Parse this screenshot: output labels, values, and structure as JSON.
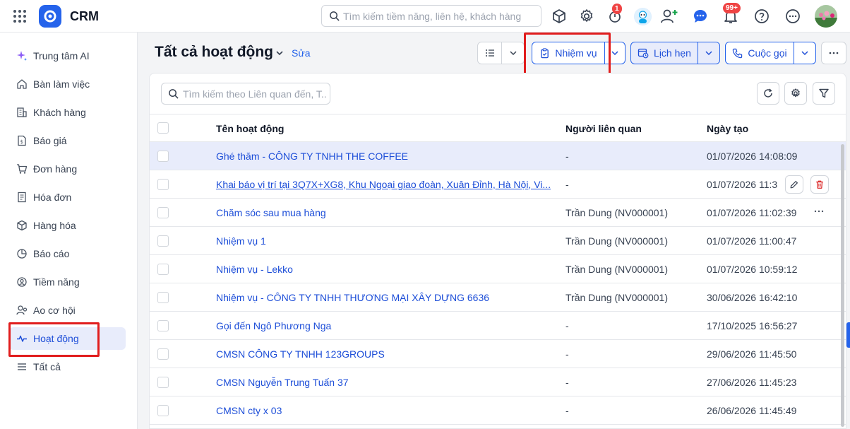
{
  "app": {
    "name": "CRM"
  },
  "search": {
    "placeholder": "Tìm kiếm tiềm năng, liên hệ, khách hàng"
  },
  "notifications": {
    "timer_badge": "1",
    "bell_badge": "99+"
  },
  "sidebar": {
    "items": [
      {
        "label": "Trung tâm AI",
        "icon": "sparkle-icon"
      },
      {
        "label": "Bàn làm việc",
        "icon": "home-icon"
      },
      {
        "label": "Khách hàng",
        "icon": "building-icon"
      },
      {
        "label": "Báo giá",
        "icon": "quote-icon"
      },
      {
        "label": "Đơn hàng",
        "icon": "cart-icon"
      },
      {
        "label": "Hóa đơn",
        "icon": "invoice-icon"
      },
      {
        "label": "Hàng hóa",
        "icon": "box-icon"
      },
      {
        "label": "Báo cáo",
        "icon": "chart-icon"
      },
      {
        "label": "Tiềm năng",
        "icon": "target-icon"
      },
      {
        "label": "Ao cơ hội",
        "icon": "opportunity-icon"
      },
      {
        "label": "Hoạt động",
        "icon": "activity-icon",
        "active": true
      },
      {
        "label": "Tất cả",
        "icon": "menu-icon"
      }
    ]
  },
  "header": {
    "title": "Tất cả hoạt động",
    "edit_label": "Sửa",
    "task_button": "Nhiệm vụ",
    "appointment_button": "Lịch hẹn",
    "call_button": "Cuộc gọi"
  },
  "table": {
    "search_placeholder": "Tìm kiếm theo Liên quan đến, T...",
    "columns": [
      "Tên hoạt động",
      "Người liên quan",
      "Ngày tạo"
    ],
    "rows": [
      {
        "name": "Ghé thăm - CÔNG TY TNHH THE COFFEE",
        "related": "-",
        "created": "01/07/2026 14:08:09"
      },
      {
        "name": "Khai báo vị trí tại 3Q7X+XG8, Khu Ngoại giao đoàn, Xuân Đỉnh, Hà Nội, Vi...",
        "related": "-",
        "created": "01/07/2026 11:3"
      },
      {
        "name": "Chăm sóc sau mua hàng",
        "related": "Trần Dung (NV000001)",
        "created": "01/07/2026 11:02:39"
      },
      {
        "name": "Nhiệm vụ 1",
        "related": "Trần Dung (NV000001)",
        "created": "01/07/2026 11:00:47"
      },
      {
        "name": "Nhiệm vụ - Lekko",
        "related": "Trần Dung (NV000001)",
        "created": "01/07/2026 10:59:12"
      },
      {
        "name": "Nhiệm vụ - CÔNG TY TNHH THƯƠNG MẠI XÂY DỰNG 6636",
        "related": "Trần Dung (NV000001)",
        "created": "30/06/2026 16:42:10"
      },
      {
        "name": "Gọi đến Ngô Phương Nga",
        "related": "-",
        "created": "17/10/2025 16:56:27"
      },
      {
        "name": "CMSN CÔNG TY TNHH 123GROUPS",
        "related": "-",
        "created": "29/06/2026 11:45:50"
      },
      {
        "name": "CMSN Nguyễn Trung Tuấn 37",
        "related": "-",
        "created": "27/06/2026 11:45:23"
      },
      {
        "name": "CMSN cty x 03",
        "related": "-",
        "created": "26/06/2026 11:45:49"
      }
    ]
  },
  "colors": {
    "accent": "#2563eb",
    "highlight": "#e11d1d",
    "selected_row": "#e8ecfb"
  }
}
